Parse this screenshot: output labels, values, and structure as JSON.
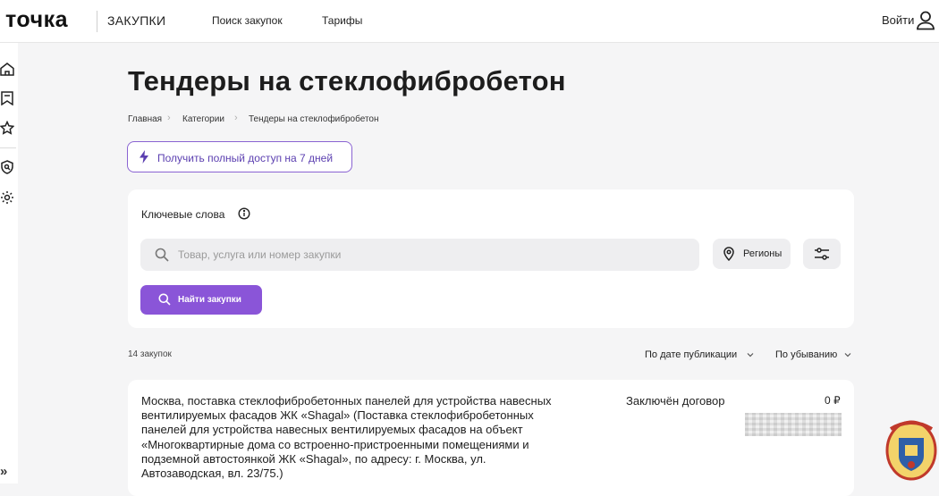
{
  "header": {
    "logo": "точка",
    "subtitle": "ЗАКУПКИ",
    "nav": [
      "Поиск закупок",
      "Тарифы"
    ],
    "login": "Войти"
  },
  "page": {
    "title": "Тендеры на стеклофибробетон",
    "breadcrumb": [
      "Главная",
      "Категории",
      "Тендеры на стеклофибробетон"
    ],
    "promo": "Получить полный доступ на 7 дней"
  },
  "search": {
    "keywords_label": "Ключевые слова",
    "placeholder": "Товар, услуга или номер закупки",
    "value": "",
    "regions": "Регионы",
    "find": "Найти закупки"
  },
  "results": {
    "count": "14 закупок",
    "sort_by": "По дате публикации",
    "sort_order": "По убыванию",
    "items": [
      {
        "description": "Москва, поставка стеклофибробетонных панелей для устройства навесных вентилируемых фасадов ЖК «Shagal» (Поставка стеклофибробетонных панелей для устройства навесных вентилируемых фасадов на объект «Многоквартирные дома со встроенно-пристроенными помещениями и подземной автостоянкой ЖК «Shagal», по адресу: г. Москва, ул. Автозаводская, вл. 23/75.)",
        "status": "Заключён договор",
        "price": "0 ₽"
      }
    ]
  },
  "colors": {
    "accent": "#8a55d8",
    "promo_border": "#8a63d2",
    "background": "#f5f5f6"
  },
  "icons": {
    "sidebar": [
      "home-icon",
      "bookmark-icon",
      "star-icon",
      "shield-search-icon",
      "settings-icon"
    ],
    "expand": "chevrons-right-icon"
  }
}
